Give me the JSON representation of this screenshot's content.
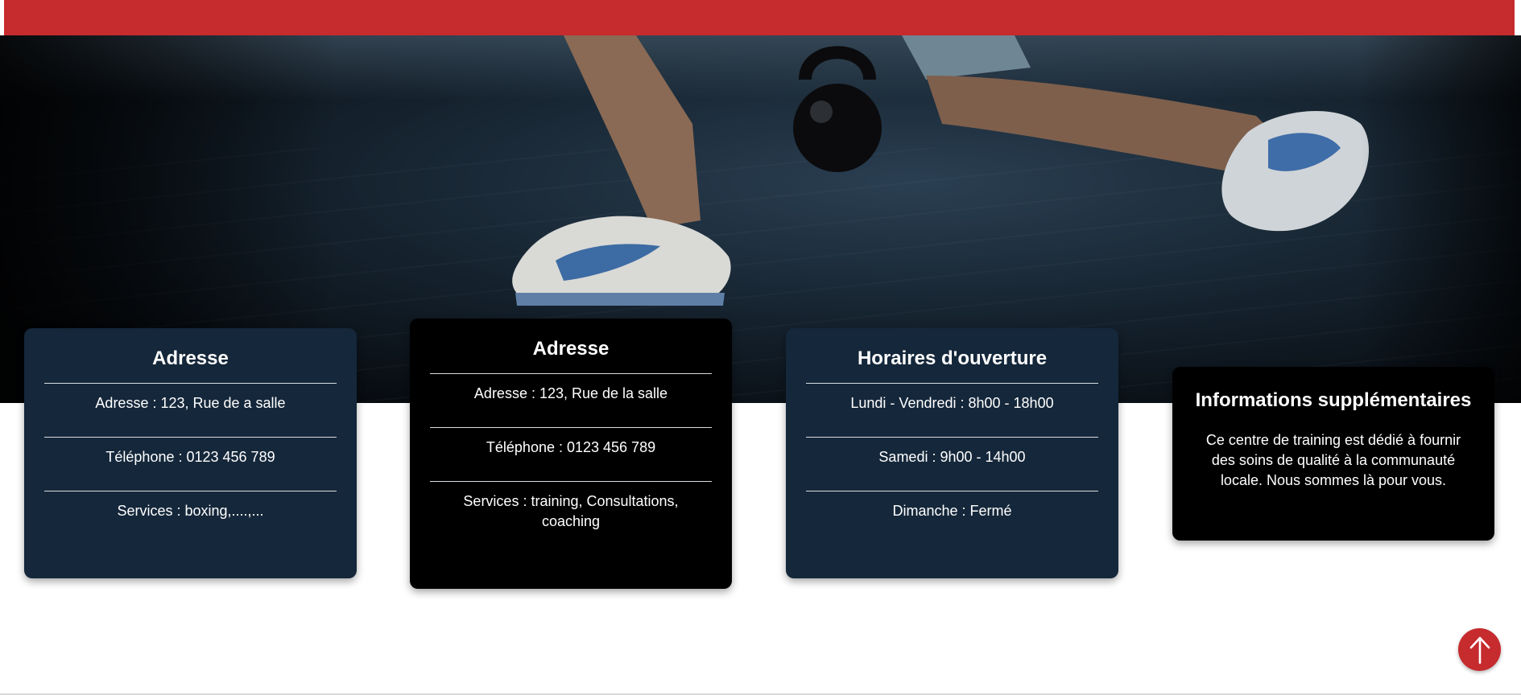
{
  "header": {
    "bar_color": "#c62b2d"
  },
  "hero": {
    "image": "gym-lunge-kettlebell-photo"
  },
  "cards": [
    {
      "title": "Adresse",
      "lines": [
        "Adresse : 123, Rue de a salle",
        "Téléphone : 0123 456 789",
        "Services : boxing,....,..."
      ]
    },
    {
      "title": "Adresse",
      "lines": [
        "Adresse : 123, Rue de la salle",
        "Téléphone : 0123 456 789",
        "Services : training, Consultations,",
        "coaching"
      ]
    },
    {
      "title": "Horaires d'ouverture",
      "lines": [
        "Lundi - Vendredi : 8h00 - 18h00",
        "Samedi : 9h00 - 14h00",
        "Dimanche : Fermé"
      ]
    },
    {
      "title": "Informations supplémentaires",
      "lines": [
        "Ce centre de training est dédié à fournir",
        "des soins de qualité à la communauté",
        "locale. Nous sommes là pour vous."
      ]
    }
  ],
  "back_to_top": {
    "icon": "arrow-up-icon"
  },
  "colors": {
    "accent_red": "#c62b2d",
    "card_navy": "#15273a",
    "card_black": "#000000"
  }
}
